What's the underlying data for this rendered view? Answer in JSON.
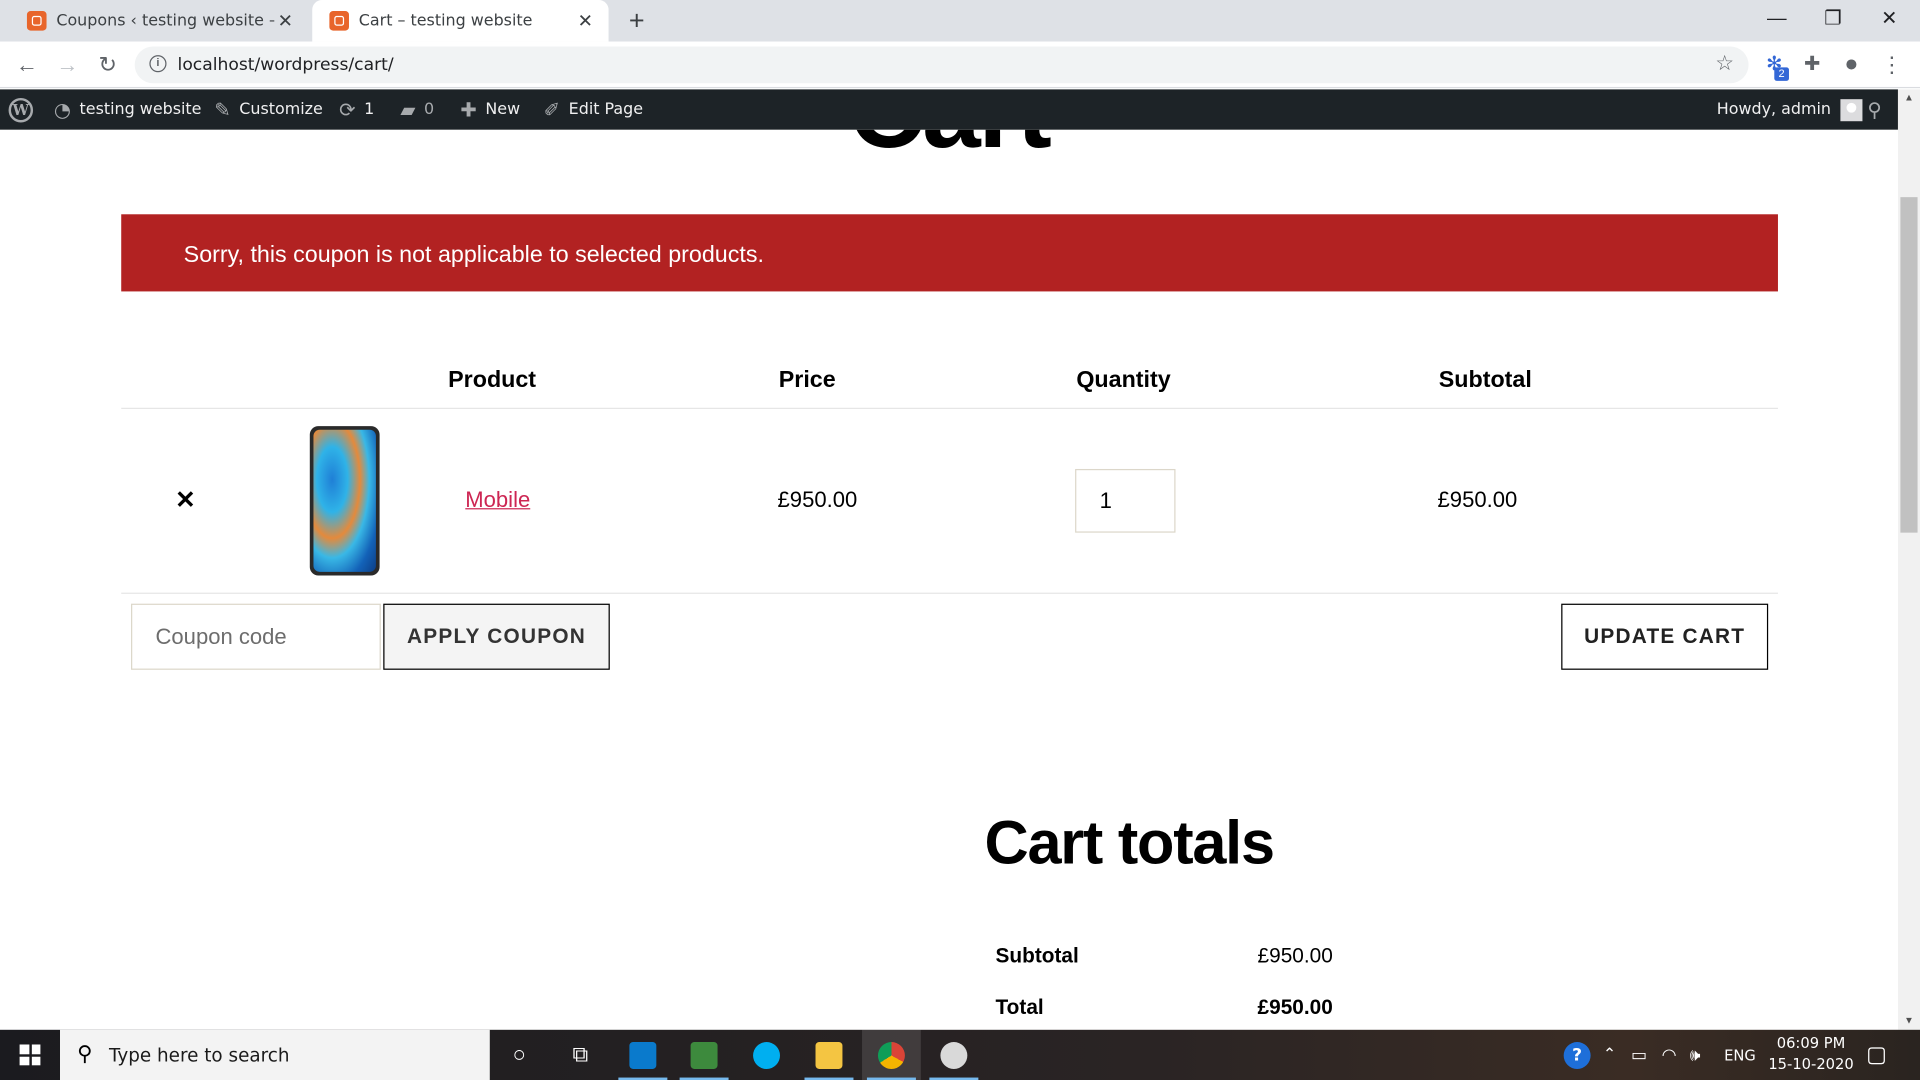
{
  "browser": {
    "tabs": [
      {
        "title": "Coupons ‹ testing website — Wo",
        "active": false
      },
      {
        "title": "Cart – testing website",
        "active": true
      }
    ],
    "url": "localhost/wordpress/cart/",
    "extension_badge": "2"
  },
  "admin_bar": {
    "site_name": "testing website",
    "customize": "Customize",
    "updates_count": "1",
    "comments_count": "0",
    "new_label": "New",
    "edit_page": "Edit Page",
    "howdy": "Howdy, admin"
  },
  "page": {
    "title": "Cart",
    "notice": "Sorry, this coupon is not applicable to selected products.",
    "table": {
      "headers": [
        "Product",
        "Price",
        "Quantity",
        "Subtotal"
      ],
      "rows": [
        {
          "product": "Mobile",
          "price": "£950.00",
          "quantity": "1",
          "subtotal": "£950.00"
        }
      ]
    },
    "coupon_placeholder": "Coupon code",
    "apply_coupon": "APPLY COUPON",
    "update_cart": "UPDATE CART",
    "totals": {
      "title": "Cart totals",
      "subtotal_label": "Subtotal",
      "subtotal_value": "£950.00",
      "total_label": "Total",
      "total_value": "£950.00"
    }
  },
  "colors": {
    "notice_bg": "#b22222",
    "link": "#cd2653",
    "admin_bar": "#1d2327"
  },
  "taskbar": {
    "search_placeholder": "Type here to search",
    "language": "ENG",
    "time": "06:09 PM",
    "date": "15-10-2020"
  }
}
